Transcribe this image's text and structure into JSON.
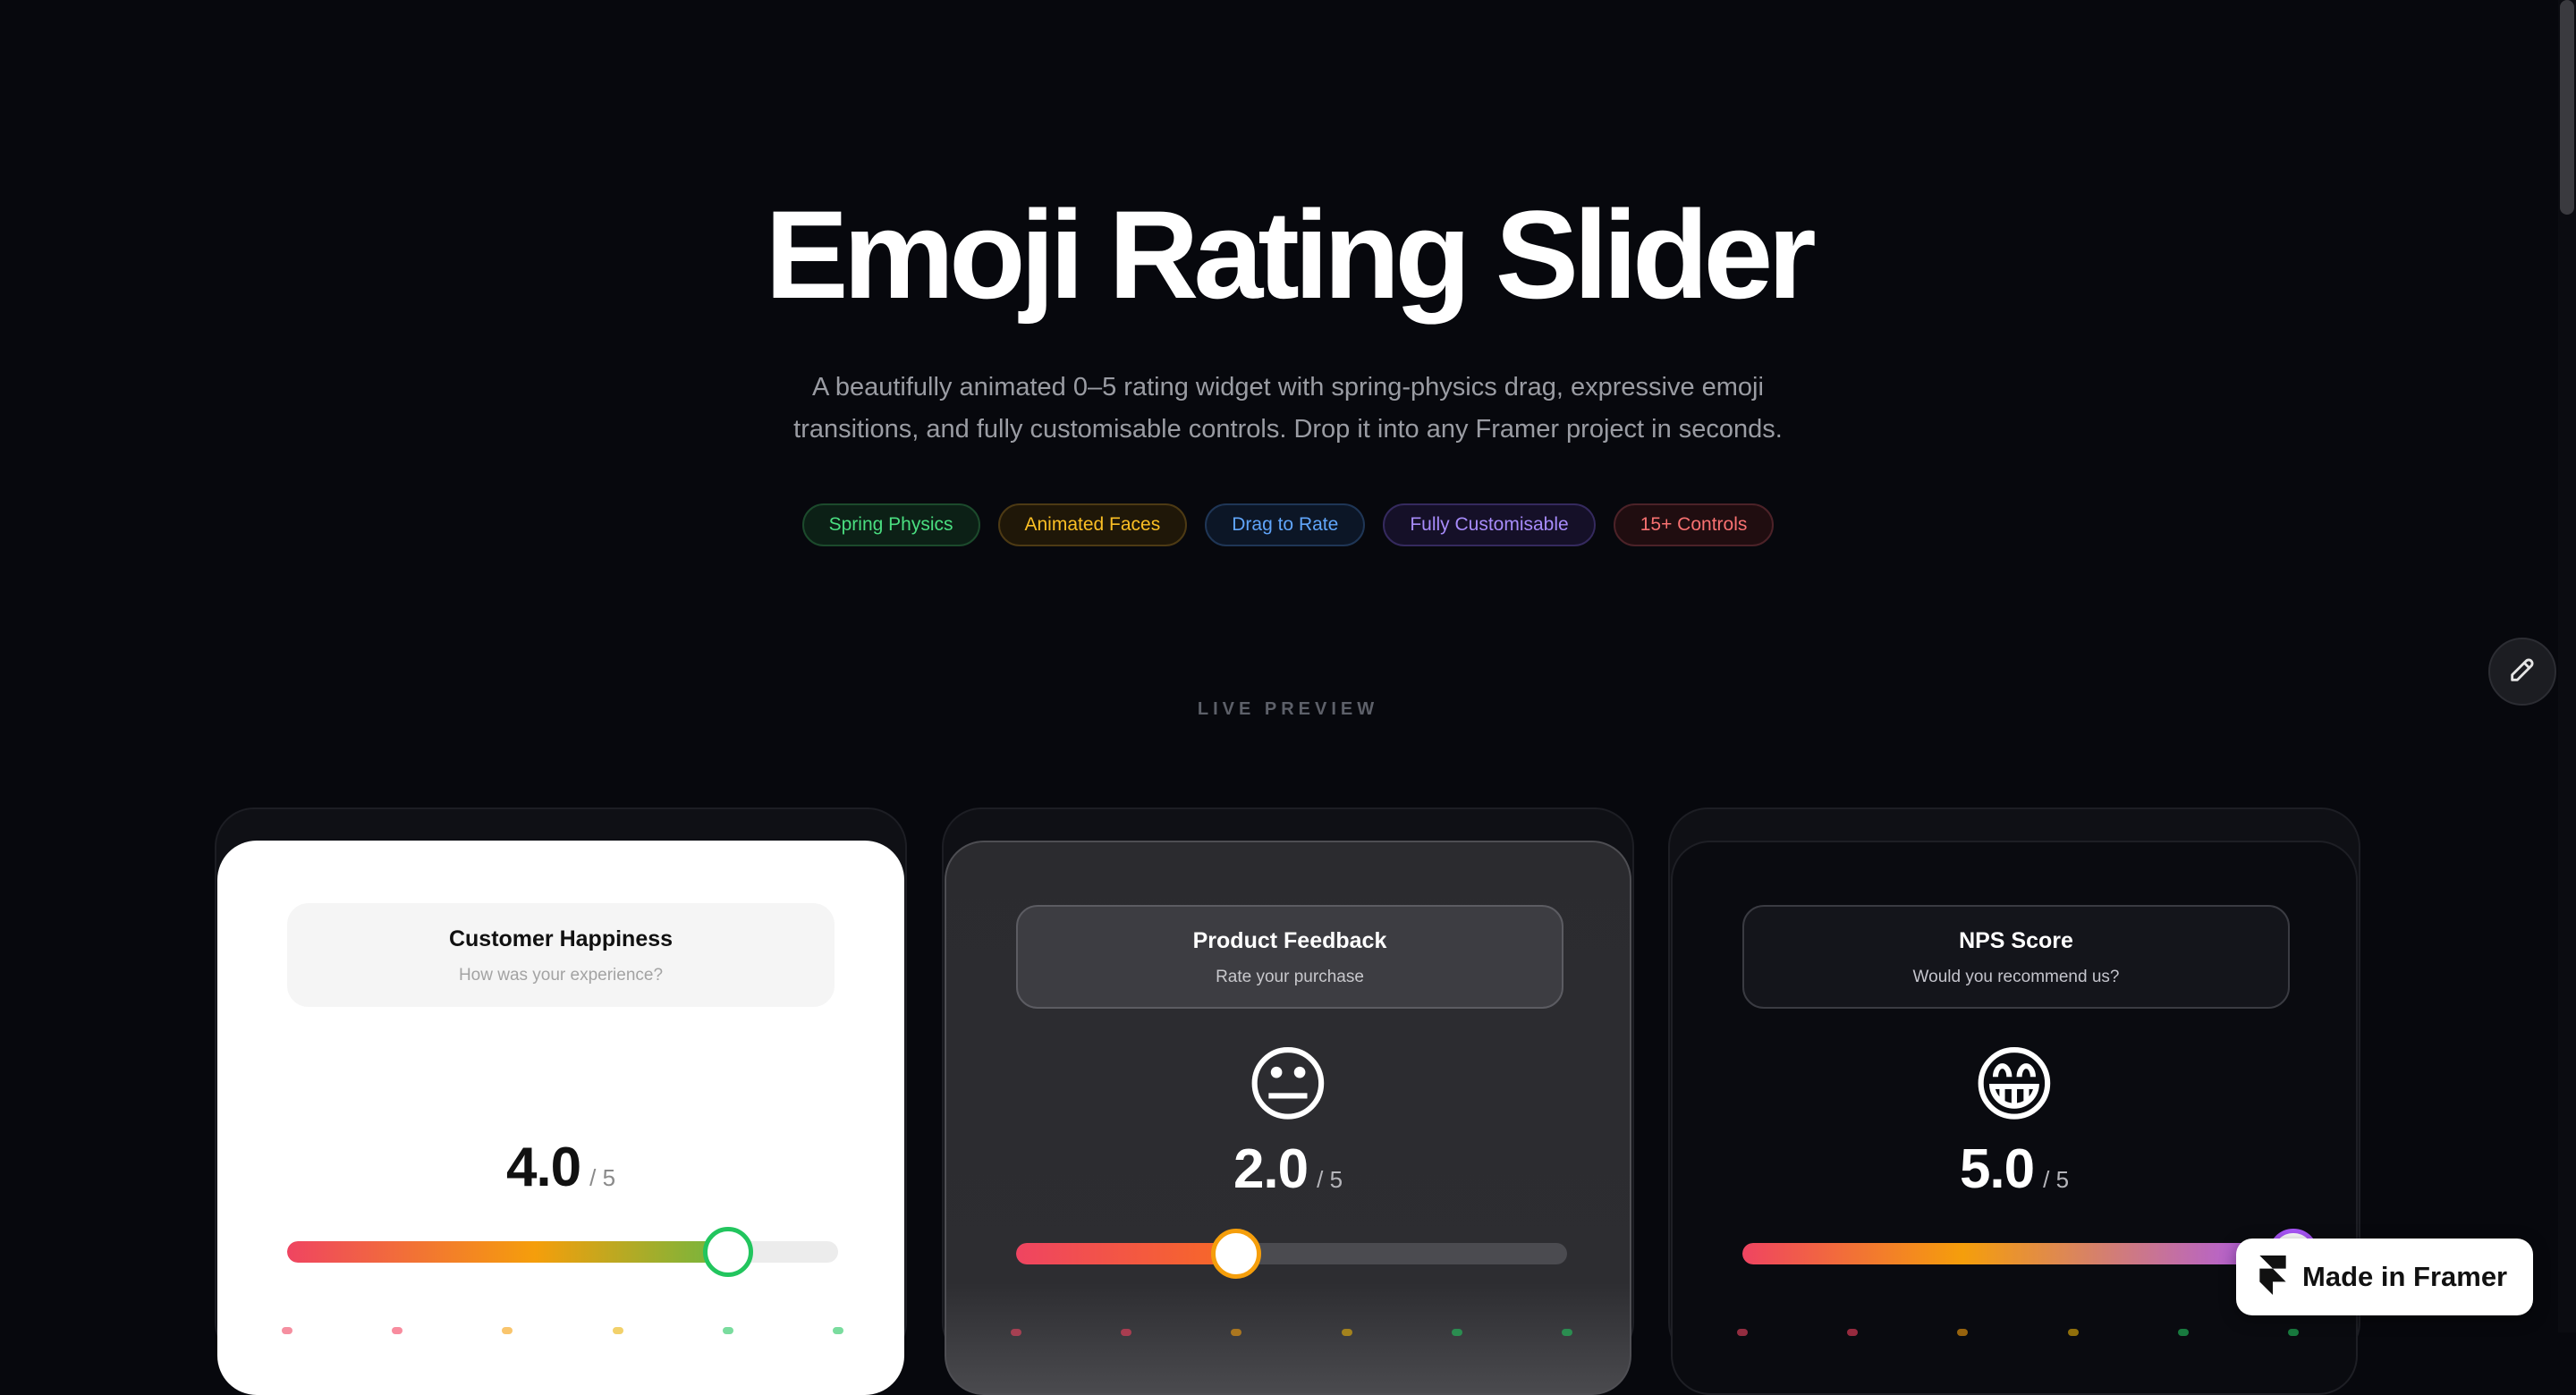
{
  "page": {
    "title": "Emoji Rating Slider",
    "subtitle_line1": "A beautifully animated 0–5 rating widget with spring-physics drag, expressive emoji",
    "subtitle_line2": "transitions, and fully customisable controls. Drop it into any Framer project in seconds."
  },
  "pills": [
    {
      "label": "Spring Physics",
      "color": "#4ade80",
      "bg": "#0c2016",
      "border": "#1c4a2c"
    },
    {
      "label": "Animated Faces",
      "color": "#fbbf24",
      "bg": "#1f1708",
      "border": "#4d3a14"
    },
    {
      "label": "Drag to Rate",
      "color": "#60a5fa",
      "bg": "#0c1626",
      "border": "#1f3656"
    },
    {
      "label": "Fully Customisable",
      "color": "#a78bfa",
      "bg": "#151028",
      "border": "#352a5e"
    },
    {
      "label": "15+ Controls",
      "color": "#f87171",
      "bg": "#200d10",
      "border": "#4c2228"
    }
  ],
  "section": {
    "label": "LIVE PREVIEW"
  },
  "icons": {
    "edit": "pencil-icon",
    "framer": "framer-logo-icon"
  },
  "cards": [
    {
      "theme": "light",
      "title": "Customer Happiness",
      "subtitle": "How was your experience?",
      "emoji": "😊",
      "score": "4.0",
      "max": "/ 5",
      "value_fraction": 0.8,
      "fill_gradient": "linear-gradient(90deg,#ef4461 0%,#f59e0b 45%,#22c55e 100%)",
      "track_bg": "#ececec",
      "thumb_border": "#22c55e",
      "thumb_bg": "#ffffff",
      "title_color": "#111111",
      "sub_color": "#a3a3a3",
      "box_bg": "#f5f5f5",
      "box_border": "#f5f5f5",
      "score_color": "#111111",
      "max_color": "#8a8a8a"
    },
    {
      "theme": "mid",
      "title": "Product Feedback",
      "subtitle": "Rate your purchase",
      "emoji": "😐",
      "score": "2.0",
      "max": "/ 5",
      "value_fraction": 0.4,
      "fill_gradient": "linear-gradient(90deg,#ef4461 0%,#f97316 50%,#f59e0b 100%)",
      "track_bg": "#4b4b50",
      "thumb_border": "#f59e0b",
      "thumb_bg": "#ffffff",
      "title_color": "#ffffff",
      "sub_color": "#c8c8cc",
      "box_bg": "#3d3d42",
      "box_border": "#5c5c62",
      "score_color": "#ffffff",
      "max_color": "#b5b5ba"
    },
    {
      "theme": "dark",
      "title": "NPS Score",
      "subtitle": "Would you recommend us?",
      "emoji": "😁",
      "score": "5.0",
      "max": "/ 5",
      "value_fraction": 1.0,
      "fill_gradient": "linear-gradient(90deg,#ef4461 0%,#f59e0b 40%,#a855f7 100%)",
      "track_bg": "#26272d",
      "thumb_border": "#a855f7",
      "thumb_bg": "#ffffff",
      "title_color": "#ffffff",
      "sub_color": "#c4c4cc",
      "box_bg": "#14151b",
      "box_border": "#3a3b42",
      "score_color": "#ffffff",
      "max_color": "#b5b5ba"
    }
  ],
  "badge": {
    "label": "Made in Framer"
  }
}
